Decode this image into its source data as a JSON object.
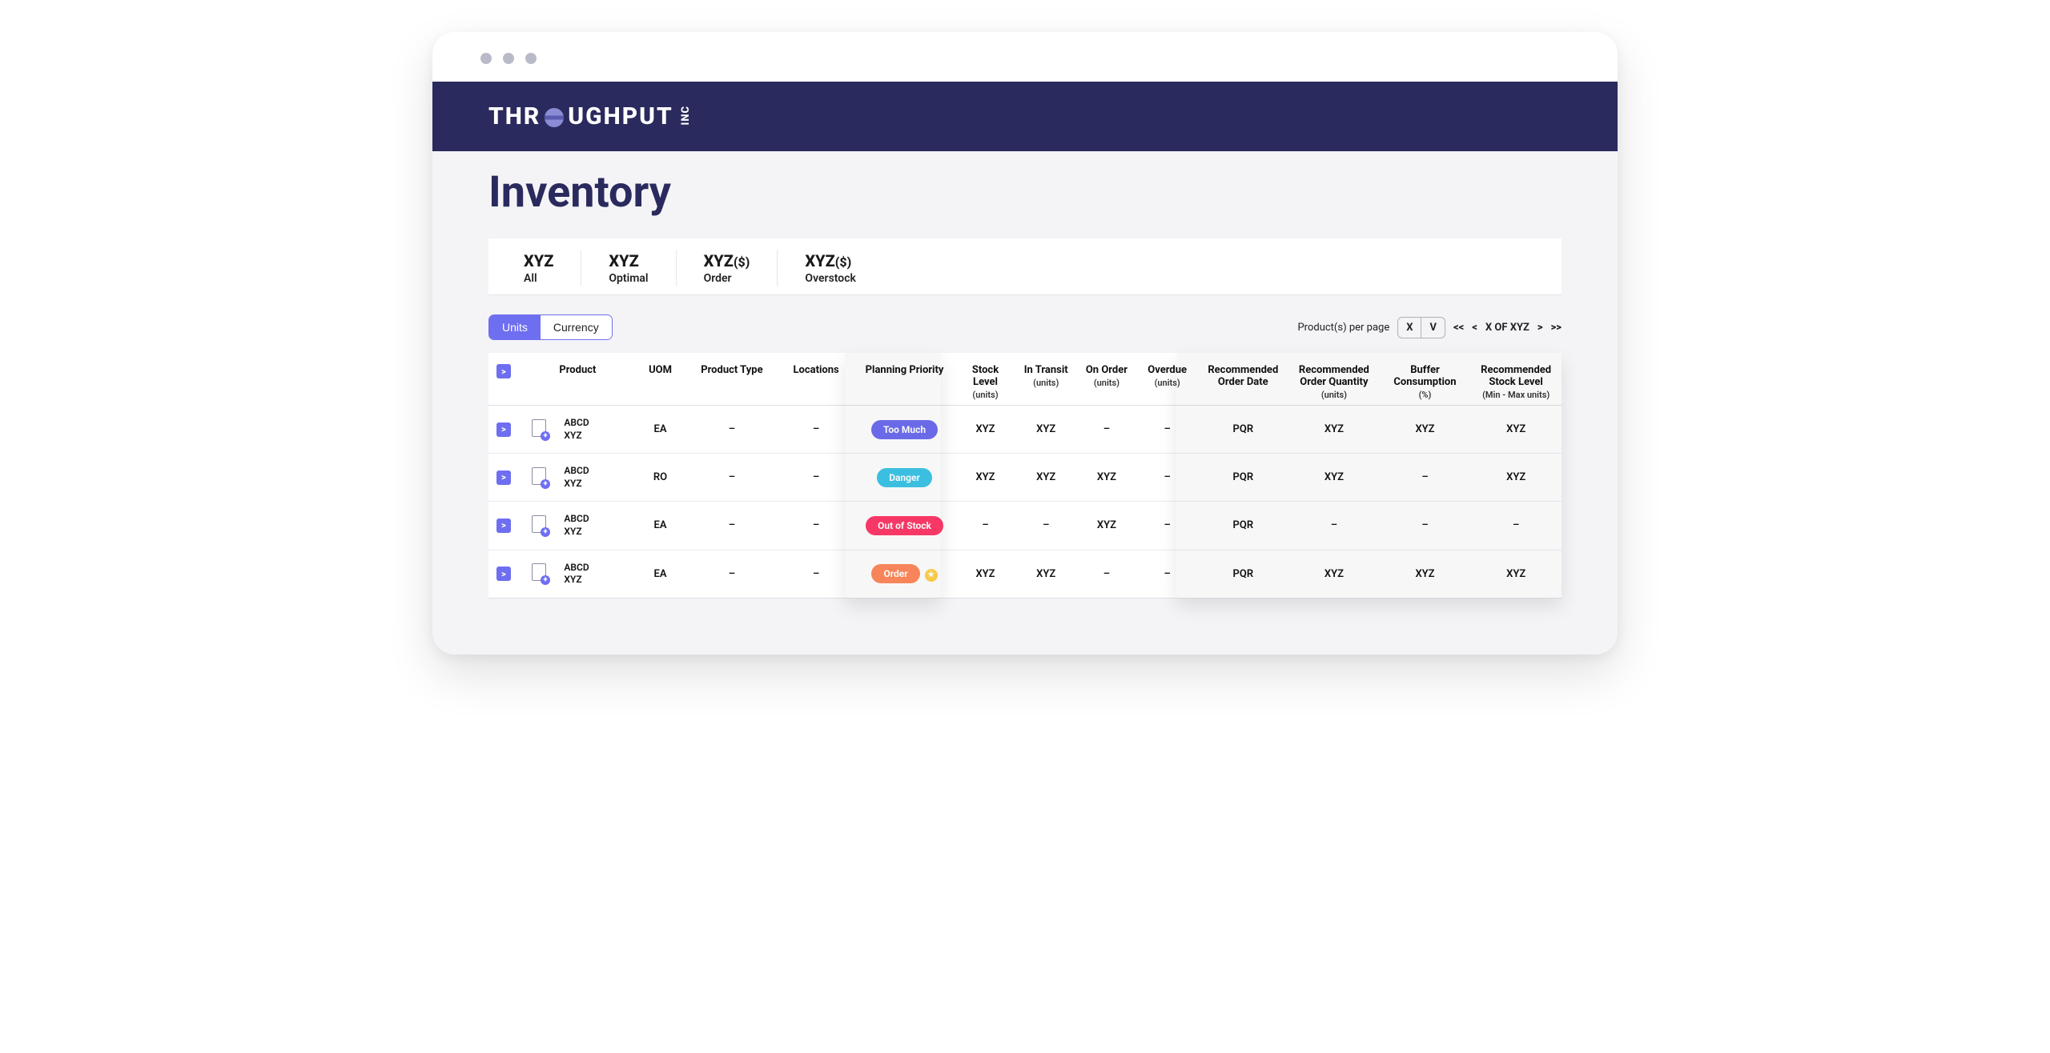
{
  "brand": {
    "main_pre": "THR",
    "main_post": "UGHPUT",
    "suffix": "INC"
  },
  "page": {
    "title": "Inventory"
  },
  "summary": [
    {
      "value": "XYZ",
      "unit": "",
      "label": "All"
    },
    {
      "value": "XYZ",
      "unit": "",
      "label": "Optimal"
    },
    {
      "value": "XYZ",
      "unit": "($)",
      "label": "Order"
    },
    {
      "value": "XYZ",
      "unit": "($)",
      "label": "Overstock"
    }
  ],
  "segments": {
    "units": "Units",
    "currency": "Currency"
  },
  "pager": {
    "perpage_label": "Product(s) per page",
    "perpage_value": "X",
    "perpage_caret": "V",
    "first": "<<",
    "prev": "<",
    "status": "X OF XYZ",
    "next": ">",
    "last": ">>"
  },
  "columns": {
    "expand": ">",
    "product": "Product",
    "uom": "UOM",
    "ptype": "Product Type",
    "locations": "Locations",
    "priority": "Planning Priority",
    "stock": "Stock Level",
    "stock_sub": "(units)",
    "transit": "In Transit",
    "transit_sub": "(units)",
    "onorder": "On Order",
    "onorder_sub": "(units)",
    "overdue": "Overdue",
    "overdue_sub": "(units)",
    "rec_date": "Recommended Order Date",
    "rec_qty": "Recommended Order Quantity",
    "rec_qty_sub": "(units)",
    "buffer": "Buffer Consumption",
    "buffer_sub": "(%)",
    "rec_stock": "Recommended Stock Level",
    "rec_stock_sub": "(Min - Max units)"
  },
  "rows": [
    {
      "product_l1": "ABCD",
      "product_l2": "XYZ",
      "uom": "EA",
      "ptype": "–",
      "locations": "–",
      "priority_label": "Too Much",
      "priority_class": "too-much",
      "star": false,
      "stock": "XYZ",
      "transit": "XYZ",
      "onorder": "–",
      "overdue": "–",
      "rec_date": "PQR",
      "rec_qty": "XYZ",
      "buffer": "XYZ",
      "rec_stock": "XYZ"
    },
    {
      "product_l1": "ABCD",
      "product_l2": "XYZ",
      "uom": "RO",
      "ptype": "–",
      "locations": "–",
      "priority_label": "Danger",
      "priority_class": "danger",
      "star": false,
      "stock": "XYZ",
      "transit": "XYZ",
      "onorder": "XYZ",
      "overdue": "–",
      "rec_date": "PQR",
      "rec_qty": "XYZ",
      "buffer": "–",
      "rec_stock": "XYZ"
    },
    {
      "product_l1": "ABCD",
      "product_l2": "XYZ",
      "uom": "EA",
      "ptype": "–",
      "locations": "–",
      "priority_label": "Out of Stock",
      "priority_class": "oos",
      "star": false,
      "stock": "–",
      "transit": "–",
      "onorder": "XYZ",
      "overdue": "–",
      "rec_date": "PQR",
      "rec_qty": "–",
      "buffer": "–",
      "rec_stock": "–"
    },
    {
      "product_l1": "ABCD",
      "product_l2": "XYZ",
      "uom": "EA",
      "ptype": "–",
      "locations": "–",
      "priority_label": "Order",
      "priority_class": "order",
      "star": true,
      "stock": "XYZ",
      "transit": "XYZ",
      "onorder": "–",
      "overdue": "–",
      "rec_date": "PQR",
      "rec_qty": "XYZ",
      "buffer": "XYZ",
      "rec_stock": "XYZ"
    }
  ]
}
